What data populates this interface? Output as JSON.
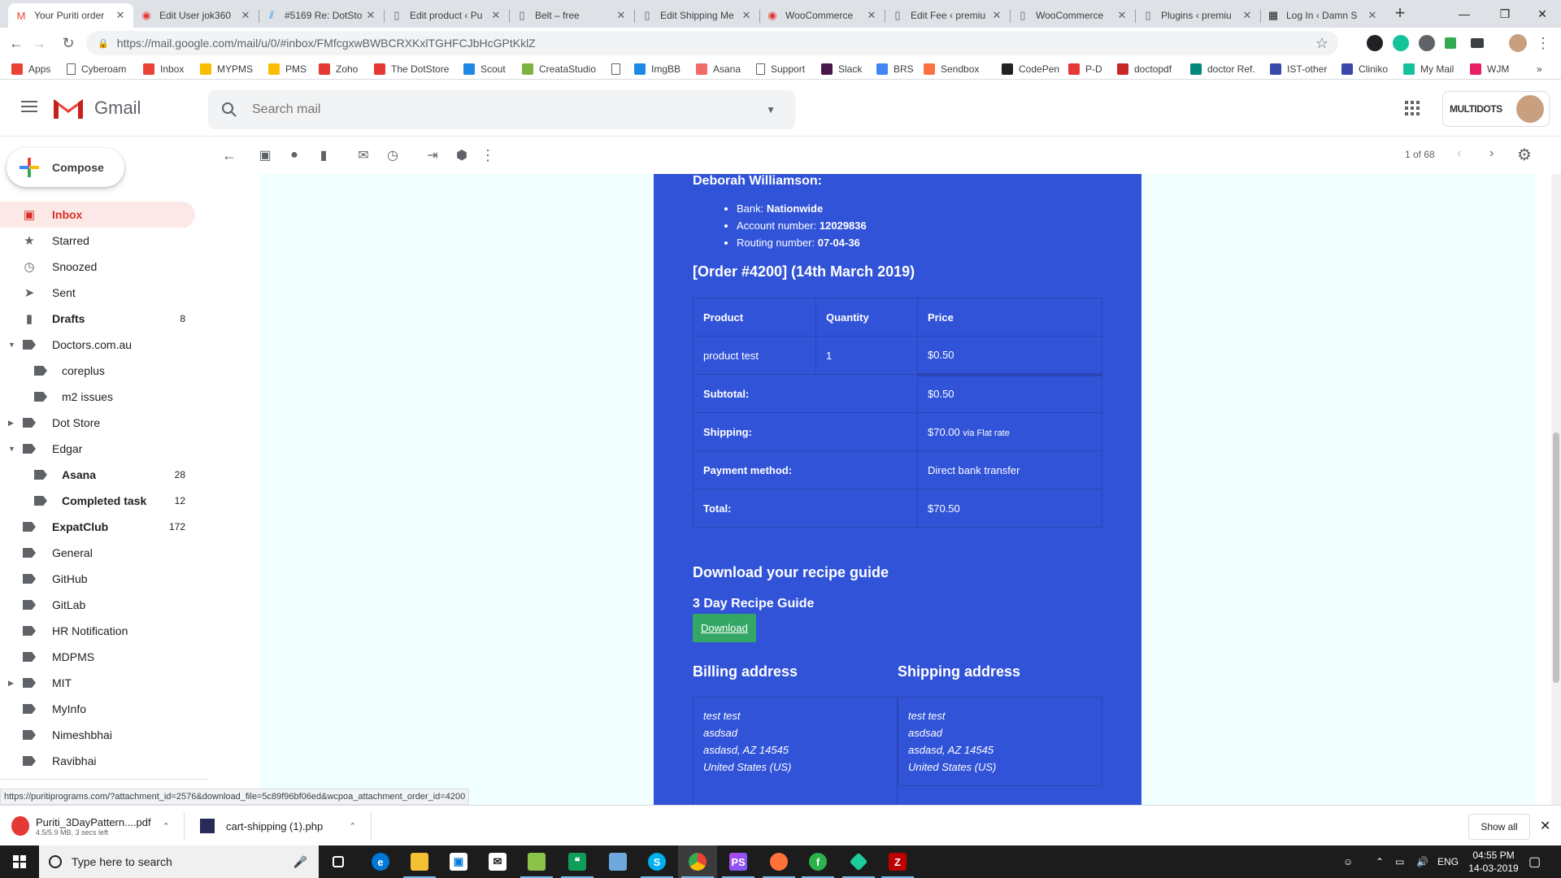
{
  "browser": {
    "tabs": [
      {
        "label": "Your Puriti order",
        "icon": "gmail-icon",
        "color": "#ea4335",
        "active": true
      },
      {
        "label": "Edit User jok360",
        "icon": "wordpress-icon",
        "color": "#e53935"
      },
      {
        "label": "#5169 Re: DotSto",
        "icon": "scout-icon",
        "color": "#1e88e5"
      },
      {
        "label": "Edit product ‹ Pu",
        "icon": "page-icon",
        "color": "#5f6368"
      },
      {
        "label": "Belt – free",
        "icon": "page-icon",
        "color": "#5f6368"
      },
      {
        "label": "Edit Shipping Me",
        "icon": "page-icon",
        "color": "#5f6368"
      },
      {
        "label": "WooCommerce",
        "icon": "wordpress-icon",
        "color": "#e53935"
      },
      {
        "label": "Edit Fee ‹ premiu",
        "icon": "page-icon",
        "color": "#5f6368"
      },
      {
        "label": "WooCommerce",
        "icon": "page-icon",
        "color": "#5f6368"
      },
      {
        "label": "Plugins ‹ premiu",
        "icon": "page-icon",
        "color": "#5f6368"
      },
      {
        "label": "Log In ‹ Damn S",
        "icon": "dashboard-icon",
        "color": "#202124"
      }
    ],
    "url": "https://mail.google.com/mail/u/0/#inbox/FMfcgxwBWBCRXKxlTGHFCJbHcGPtKklZ",
    "bookmarks": [
      {
        "label": "Apps",
        "icon": "apps-grid-icon",
        "color": "#ea4335"
      },
      {
        "label": "Cyberoam",
        "icon": "page-icon",
        "color": "#ffffff"
      },
      {
        "label": "Inbox",
        "icon": "gmail-icon",
        "color": "#ea4335"
      },
      {
        "label": "MYPMS",
        "icon": "chrome-icon",
        "color": "#fbbc04"
      },
      {
        "label": "PMS",
        "icon": "chrome-icon",
        "color": "#fbbc04"
      },
      {
        "label": "Zoho",
        "icon": "zoho-icon",
        "color": "#e53935"
      },
      {
        "label": "The DotStore",
        "icon": "dotstore-icon",
        "color": "#e53935"
      },
      {
        "label": "Scout",
        "icon": "scout-icon",
        "color": "#1e88e5"
      },
      {
        "label": "CreataStudio",
        "icon": "leaf-icon",
        "color": "#7cb342"
      },
      {
        "label": "",
        "icon": "page-icon",
        "color": "#ffffff"
      },
      {
        "label": "ImgBB",
        "icon": "imgbb-icon",
        "color": "#1e88e5"
      },
      {
        "label": "Asana",
        "icon": "asana-icon",
        "color": "#f06a6a"
      },
      {
        "label": "Support",
        "icon": "page-icon",
        "color": "#ffffff"
      },
      {
        "label": "Slack",
        "icon": "slack-icon",
        "color": "#4a154b"
      },
      {
        "label": "BRS",
        "icon": "docs-icon",
        "color": "#4285f4"
      },
      {
        "label": "Sendbox",
        "icon": "sendbox-icon",
        "color": "#ff7043"
      },
      {
        "label": "CodePen",
        "icon": "codepen-icon",
        "color": "#202124"
      },
      {
        "label": "P-D",
        "icon": "grid-icon",
        "color": "#e53935"
      },
      {
        "label": "doctopdf",
        "icon": "heart-icon",
        "color": "#c62828"
      },
      {
        "label": "doctor Ref.",
        "icon": "plus-icon",
        "color": "#00897b"
      },
      {
        "label": "IST-other",
        "icon": "ist-icon",
        "color": "#3949ab"
      },
      {
        "label": "Cliniko",
        "icon": "cliniko-icon",
        "color": "#3949ab"
      },
      {
        "label": "My Mail",
        "icon": "grammarly-icon",
        "color": "#15c39a"
      },
      {
        "label": "WJM",
        "icon": "wjm-icon",
        "color": "#e91e63"
      }
    ]
  },
  "gmail": {
    "brand": "Gmail",
    "search_placeholder": "Search mail",
    "account_brand": "MULTIDOTS",
    "compose_label": "Compose",
    "labels": [
      {
        "name": "Inbox",
        "count": "",
        "icon": "inbox-icon",
        "active": true,
        "bold": true,
        "indent": 0,
        "arrow": ""
      },
      {
        "name": "Starred",
        "count": "",
        "icon": "star-icon",
        "indent": 0,
        "arrow": ""
      },
      {
        "name": "Snoozed",
        "count": "",
        "icon": "clock-icon",
        "indent": 0,
        "arrow": ""
      },
      {
        "name": "Sent",
        "count": "",
        "icon": "send-icon",
        "indent": 0,
        "arrow": ""
      },
      {
        "name": "Drafts",
        "count": "8",
        "icon": "draft-icon",
        "bold": true,
        "indent": 0,
        "arrow": ""
      },
      {
        "name": "Doctors.com.au",
        "count": "",
        "icon": "label-icon",
        "indent": 0,
        "arrow": "down"
      },
      {
        "name": "coreplus",
        "count": "",
        "icon": "label-icon",
        "indent": 1,
        "arrow": ""
      },
      {
        "name": "m2 issues",
        "count": "",
        "icon": "label-icon",
        "indent": 1,
        "arrow": ""
      },
      {
        "name": "Dot Store",
        "count": "",
        "icon": "label-icon",
        "indent": 0,
        "arrow": "right"
      },
      {
        "name": "Edgar",
        "count": "",
        "icon": "label-icon",
        "indent": 0,
        "arrow": "down"
      },
      {
        "name": "Asana",
        "count": "28",
        "icon": "label-icon",
        "bold": true,
        "indent": 1,
        "arrow": ""
      },
      {
        "name": "Completed task",
        "count": "12",
        "icon": "label-icon",
        "bold": true,
        "indent": 1,
        "arrow": ""
      },
      {
        "name": "ExpatClub",
        "count": "172",
        "icon": "label-icon",
        "bold": true,
        "indent": 0,
        "arrow": ""
      },
      {
        "name": "General",
        "count": "",
        "icon": "label-icon",
        "indent": 0,
        "arrow": ""
      },
      {
        "name": "GitHub",
        "count": "",
        "icon": "label-icon",
        "indent": 0,
        "arrow": ""
      },
      {
        "name": "GitLab",
        "count": "",
        "icon": "label-icon",
        "indent": 0,
        "arrow": ""
      },
      {
        "name": "HR Notification",
        "count": "",
        "icon": "label-icon",
        "indent": 0,
        "arrow": ""
      },
      {
        "name": "MDPMS",
        "count": "",
        "icon": "label-icon",
        "indent": 0,
        "arrow": ""
      },
      {
        "name": "MIT",
        "count": "",
        "icon": "label-icon",
        "indent": 0,
        "arrow": "right"
      },
      {
        "name": "MyInfo",
        "count": "",
        "icon": "label-icon",
        "indent": 0,
        "arrow": ""
      },
      {
        "name": "Nimeshbhai",
        "count": "",
        "icon": "label-icon",
        "indent": 0,
        "arrow": ""
      },
      {
        "name": "Ravibhai",
        "count": "",
        "icon": "label-icon",
        "indent": 0,
        "arrow": ""
      }
    ],
    "pagination": "1 of 68",
    "status_url": "https://puritiprograms.com/?attachment_id=2576&download_file=5c89f96bf06ed&wcpoa_attachment_order_id=4200"
  },
  "email": {
    "colors": {
      "background": "#3153d8",
      "button": "#35a764"
    },
    "account_holder": "Deborah Williamson:",
    "bank_lines": [
      {
        "label": "Bank:",
        "value": "Nationwide"
      },
      {
        "label": "Account number:",
        "value": "12029836"
      },
      {
        "label": "Routing number:",
        "value": "07-04-36"
      }
    ],
    "order_heading": "[Order #4200] (14th March 2019)",
    "table_headers": {
      "product": "Product",
      "quantity": "Quantity",
      "price": "Price"
    },
    "item": {
      "product": "product test",
      "quantity": "1",
      "price": "$0.50"
    },
    "totals": [
      {
        "label": "Subtotal:",
        "value": "$0.50",
        "note": ""
      },
      {
        "label": "Shipping:",
        "value": "$70.00",
        "note": "via Flat rate"
      },
      {
        "label": "Payment method:",
        "value": "Direct bank transfer",
        "note": ""
      },
      {
        "label": "Total:",
        "value": "$70.50",
        "note": ""
      }
    ],
    "recipe_heading": "Download your recipe guide",
    "recipe_title": "3 Day Recipe Guide",
    "download_label": "Download",
    "billing_heading": "Billing address",
    "shipping_heading": "Shipping address",
    "billing_lines": [
      "test test",
      "asdsad",
      "asdasd, AZ 14545",
      "United States (US)"
    ],
    "shipping_lines": [
      "test test",
      "asdsad",
      "asdasd, AZ 14545",
      "United States (US)"
    ]
  },
  "downloads": [
    {
      "name": "Puriti_3DayPattern....pdf",
      "meta": "4.5/5.9 MB, 3 secs left",
      "icon": "pdf-icon"
    },
    {
      "name": "cart-shipping (1).php",
      "meta": "",
      "icon": "php-icon"
    }
  ],
  "shelf": {
    "show_all": "Show all"
  },
  "taskbar": {
    "search_placeholder": "Type here to search",
    "lang": "ENG",
    "time": "04:55 PM",
    "date": "14-03-2019"
  }
}
